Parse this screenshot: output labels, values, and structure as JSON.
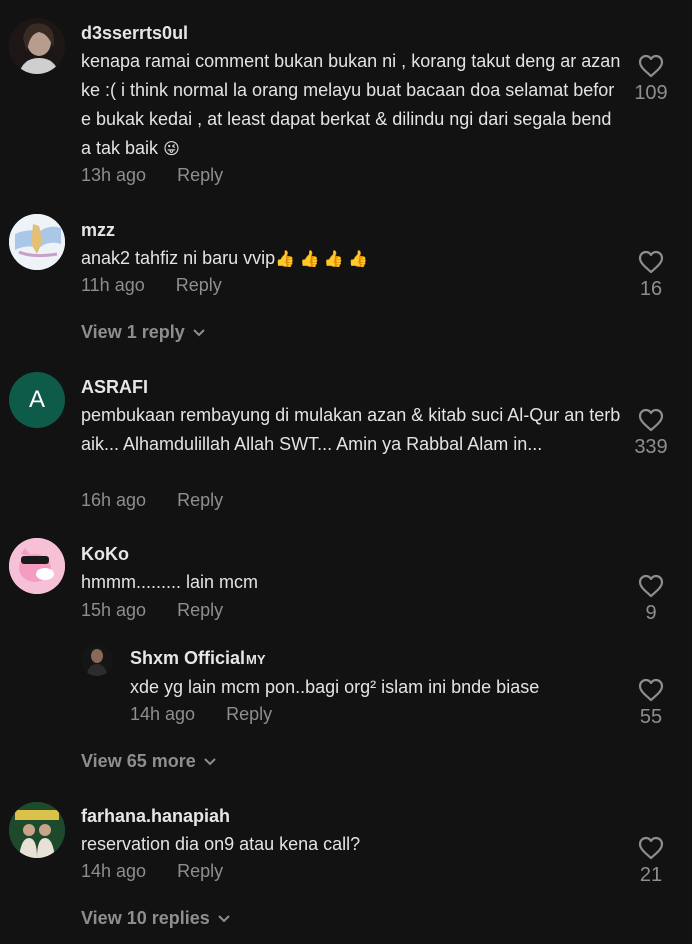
{
  "comments": [
    {
      "username": "d3sserrts0ul",
      "text": "kenapa ramai comment bukan bukan ni , korang takut deng ar azan ke :( i think normal la orang melayu buat bacaan doa selamat before bukak kedai , at least dapat berkat & dilindu ngi dari segala benda tak baik",
      "emoji": "😜",
      "time": "13h ago",
      "reply": "Reply",
      "likes": "109"
    },
    {
      "username": "mzz",
      "text": "anak2 tahfiz ni baru vvip",
      "emoji": "👍 👍 👍 👍",
      "time": "11h ago",
      "reply": "Reply",
      "likes": "16",
      "view_replies": "View 1 reply"
    },
    {
      "username": "ASRAFI",
      "avatar_letter": "A",
      "text": "pembukaan rembayung di mulakan azan & kitab suci Al-Qur an terbaik... Alhamdulillah Allah SWT... Amin ya Rabbal Alam in...",
      "time": "16h ago",
      "reply": "Reply",
      "likes": "339"
    },
    {
      "username": "KoKo",
      "text": "hmmm......... lain mcm",
      "time": "15h ago",
      "reply": "Reply",
      "likes": "9",
      "sub_reply": {
        "username": "Shxm Official",
        "badge": "MY",
        "text": "xde yg lain mcm pon..bagi org² islam ini bnde biase",
        "time": "14h ago",
        "reply": "Reply",
        "likes": "55"
      },
      "view_replies": "View 65 more"
    },
    {
      "username": "farhana.hanapiah",
      "text": "reservation dia on9 atau kena call?",
      "time": "14h ago",
      "reply": "Reply",
      "likes": "21",
      "view_replies": "View 10 replies"
    }
  ],
  "colors": {
    "background": "#121212",
    "text": "#e3e3e3",
    "muted": "#8e8e8e",
    "asrafi_avatar": "#0f5b4a"
  }
}
